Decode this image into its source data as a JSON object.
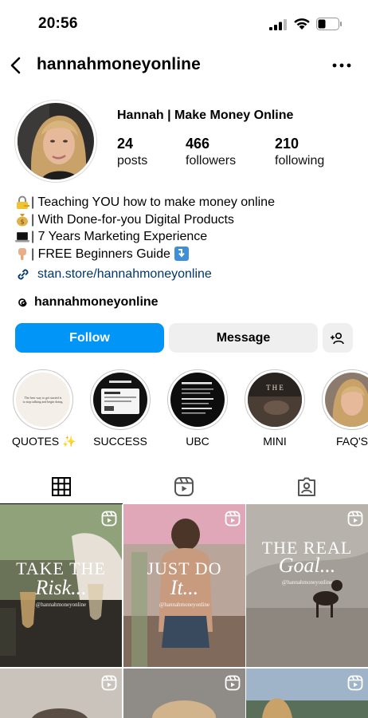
{
  "status_bar": {
    "time": "20:56",
    "icons": [
      "signal-icon",
      "wifi-icon",
      "battery-icon"
    ]
  },
  "header": {
    "username": "hannahmoneyonline",
    "back_icon": "chevron-left-icon",
    "more_icon": "more-horizontal-icon"
  },
  "profile": {
    "display_name": "Hannah | Make Money Online",
    "stats": [
      {
        "value": "24",
        "label": "posts"
      },
      {
        "value": "466",
        "label": "followers"
      },
      {
        "value": "210",
        "label": "following"
      }
    ],
    "bio": [
      {
        "emoji": "lock-key-icon",
        "text": "| Teaching YOU how to make money online"
      },
      {
        "emoji": "money-bag-icon",
        "text": "| With Done-for-you Digital Products"
      },
      {
        "emoji": "laptop-icon",
        "text": "| 7 Years Marketing Experience"
      },
      {
        "emoji": "pointing-down-icon",
        "text": "| FREE Beginners Guide"
      }
    ],
    "link": "stan.store/hannahmoneyonline",
    "threads_handle": "hannahmoneyonline"
  },
  "actions": {
    "follow": "Follow",
    "message": "Message",
    "suggest_icon": "add-person-icon"
  },
  "highlights": [
    {
      "label": "QUOTES ✨",
      "thumb_text": "The best way to get started is to stop talking and begin doing."
    },
    {
      "label": "SUCCESS"
    },
    {
      "label": "UBC",
      "thumb_text": "UBC vs. 10 Reasons"
    },
    {
      "label": "MINI"
    },
    {
      "label": "FAQ'S"
    }
  ],
  "tabs": [
    {
      "name": "posts",
      "icon": "grid-icon",
      "active": true
    },
    {
      "name": "reels",
      "icon": "reels-icon",
      "active": false
    },
    {
      "name": "tagged",
      "icon": "tagged-icon",
      "active": false
    }
  ],
  "posts": [
    {
      "line1": "TAKE THE",
      "line2": "Risk...",
      "handle": "@hannahmoneyonline",
      "reel": true
    },
    {
      "line1": "JUST DO",
      "line2": "It...",
      "handle": "@hannahmoneyonline",
      "reel": true
    },
    {
      "line1": "THE REAL",
      "line2": "Goal...",
      "handle": "@hannahmoneyonline",
      "reel": true
    },
    {
      "reel": true
    },
    {
      "reel": true
    },
    {
      "reel": true
    }
  ],
  "colors": {
    "follow_blue": "#0095f6",
    "button_grey": "#efefef",
    "link_blue": "#00376b"
  }
}
